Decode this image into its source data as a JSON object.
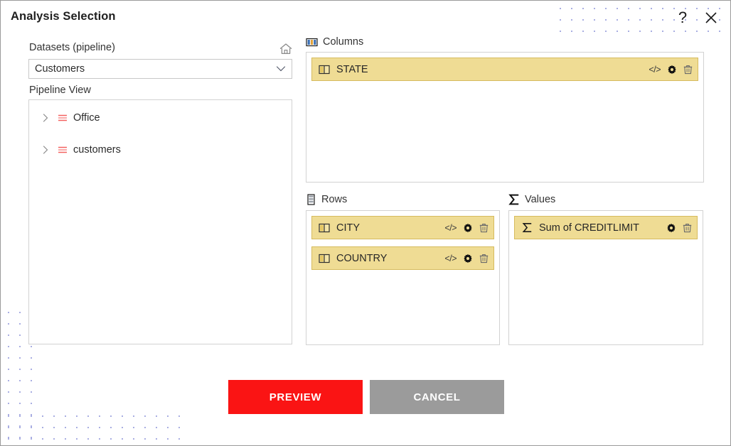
{
  "window": {
    "title": "Analysis Selection",
    "help_icon": "question-mark-icon",
    "close_icon": "close-icon"
  },
  "left_panel": {
    "datasets_label": "Datasets (pipeline)",
    "home_icon": "home-icon",
    "dataset_select": {
      "value": "Customers",
      "chevron_icon": "chevron-down-icon"
    },
    "pipeline_view_label": "Pipeline View",
    "tree_items": [
      {
        "label": "Office",
        "chevron_icon": "chevron-right-icon",
        "table_icon": "table-lines-icon",
        "expanded": false
      },
      {
        "label": "customers",
        "chevron_icon": "chevron-right-icon",
        "table_icon": "table-lines-icon",
        "expanded": false
      }
    ]
  },
  "zones": {
    "columns": {
      "title": "Columns",
      "icon": "columns-icon",
      "fields": [
        {
          "label": "STATE",
          "icon": "column-field-icon",
          "actions": [
            {
              "name": "code-icon",
              "glyph": "</>"
            },
            {
              "name": "gear-icon"
            },
            {
              "name": "trash-icon"
            }
          ]
        }
      ]
    },
    "rows": {
      "title": "Rows",
      "icon": "rows-icon",
      "fields": [
        {
          "label": "CITY",
          "icon": "column-field-icon",
          "actions": [
            {
              "name": "code-icon",
              "glyph": "</>"
            },
            {
              "name": "gear-icon"
            },
            {
              "name": "trash-icon"
            }
          ]
        },
        {
          "label": "COUNTRY",
          "icon": "column-field-icon",
          "actions": [
            {
              "name": "code-icon",
              "glyph": "</>"
            },
            {
              "name": "gear-icon"
            },
            {
              "name": "trash-icon"
            }
          ]
        }
      ]
    },
    "values": {
      "title": "Values",
      "icon": "sigma-icon",
      "fields": [
        {
          "label": "Sum of CREDITLIMIT",
          "icon": "sigma-field-icon",
          "actions": [
            {
              "name": "gear-icon"
            },
            {
              "name": "trash-icon"
            }
          ]
        }
      ]
    }
  },
  "footer": {
    "preview_label": "PREVIEW",
    "cancel_label": "CANCEL"
  },
  "colors": {
    "preview_button": "#fa1414",
    "cancel_button": "#9b9b9b",
    "chip_background": "#efdc94",
    "chip_border": "#d6bb5f",
    "tree_icon": "#f4605f",
    "dot_pattern": "#8c93d8"
  }
}
